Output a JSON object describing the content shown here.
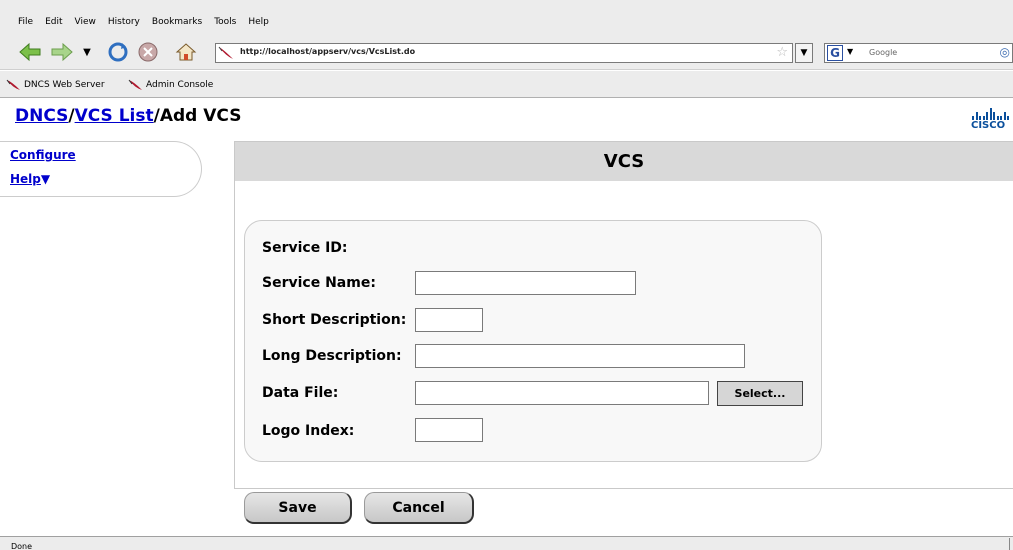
{
  "menu": [
    "File",
    "Edit",
    "View",
    "History",
    "Bookmarks",
    "Tools",
    "Help"
  ],
  "toolbar": {
    "url": "http://localhost/appserv/vcs/VcsList.do",
    "search_placeholder": "Google",
    "search_engine_icon": "G"
  },
  "bookmarks": [
    "DNCS Web Server",
    "Admin Console"
  ],
  "breadcrumb": {
    "part1": "DNCS",
    "sep1": "/",
    "part2": "VCS List",
    "sep2": "/",
    "current": "Add VCS"
  },
  "logo": {
    "text": "CISCO"
  },
  "sidebar": {
    "configure": "Configure",
    "help": "Help",
    "help_arrow": "▼"
  },
  "panel": {
    "title": "VCS"
  },
  "form": {
    "service_id_label": "Service ID:",
    "service_name_label": "Service Name:",
    "short_desc_label": "Short Description:",
    "long_desc_label": "Long Description:",
    "data_file_label": "Data File:",
    "logo_index_label": "Logo Index:",
    "select_label": "Select...",
    "service_name_value": "",
    "short_desc_value": "",
    "long_desc_value": "",
    "data_file_value": "",
    "logo_index_value": ""
  },
  "buttons": {
    "save": "Save",
    "cancel": "Cancel"
  },
  "status": {
    "text": "Done"
  },
  "colors": {
    "link": "#0000cc",
    "cisco_blue": "#0a4f9c",
    "header_gray": "#d9d9d9"
  }
}
